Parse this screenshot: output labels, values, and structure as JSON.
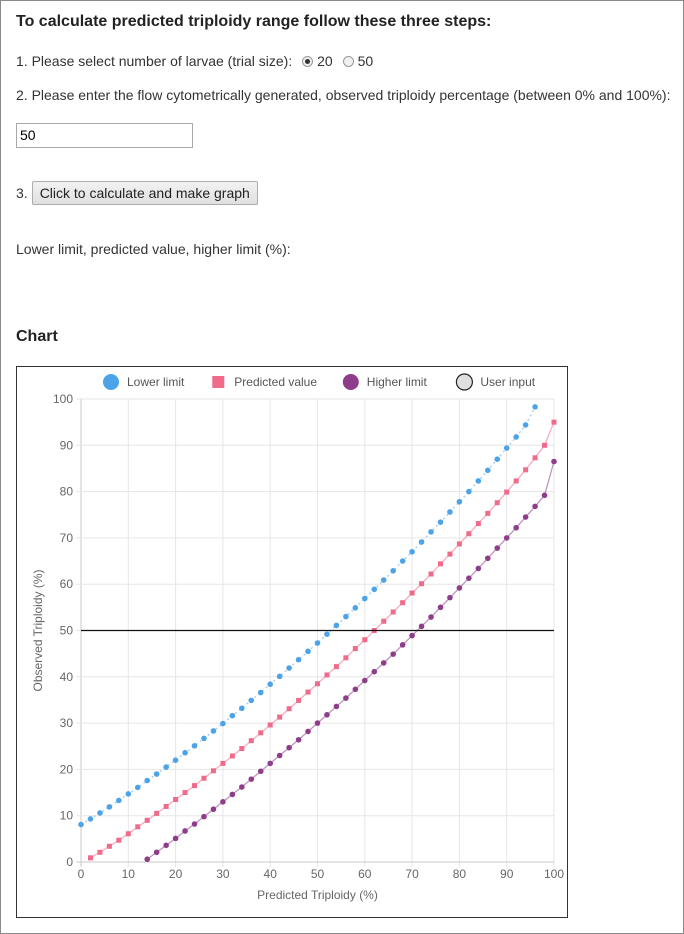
{
  "header": {
    "title": "To calculate predicted triploidy range follow these three steps:"
  },
  "step1": {
    "label": "1. Please select number of larvae (trial size):",
    "options": [
      {
        "label": "20",
        "selected": true
      },
      {
        "label": "50",
        "selected": false
      }
    ]
  },
  "step2": {
    "label": "2. Please enter the flow cytometrically generated, observed triploidy percentage (between 0% and 100%):",
    "value": "50"
  },
  "step3": {
    "prefix": "3.",
    "button_label": "Click to calculate and make graph"
  },
  "result": {
    "label": "Lower limit, predicted value, higher limit (%):"
  },
  "chart_section": {
    "title": "Chart"
  },
  "chart_data": {
    "type": "scatter",
    "xlabel": "Predicted Triploidy (%)",
    "ylabel": "Observed Triploidy (%)",
    "xlim": [
      0,
      100
    ],
    "ylim": [
      0,
      100
    ],
    "xticks": [
      "0",
      "10",
      "20",
      "30",
      "40",
      "50",
      "60",
      "70",
      "80",
      "90",
      "100"
    ],
    "yticks": [
      "0",
      "10",
      "20",
      "30",
      "40",
      "50",
      "60",
      "70",
      "80",
      "90",
      "100"
    ],
    "grid": true,
    "legend_position": "top",
    "series": [
      {
        "name": "Lower limit",
        "color": "#4da3e8",
        "marker": "circle",
        "line": "dotted",
        "x": [
          0,
          2,
          4,
          6,
          8,
          10,
          12,
          14,
          16,
          18,
          20,
          22,
          24,
          26,
          28,
          30,
          32,
          34,
          36,
          38,
          40,
          42,
          44,
          46,
          48,
          50,
          52,
          54,
          56,
          58,
          60,
          62,
          64,
          66,
          68,
          70,
          72,
          74,
          76,
          78,
          80,
          82,
          84,
          86,
          88,
          90,
          92,
          94,
          96
        ],
        "y": [
          8.1,
          9.3,
          10.6,
          11.9,
          13.3,
          14.7,
          16.1,
          17.6,
          19.0,
          20.5,
          22.0,
          23.6,
          25.1,
          26.7,
          28.3,
          29.9,
          31.6,
          33.2,
          34.9,
          36.6,
          38.4,
          40.1,
          41.9,
          43.7,
          45.5,
          47.3,
          49.2,
          51.1,
          53.0,
          54.9,
          56.9,
          58.9,
          60.9,
          62.9,
          65.0,
          67.0,
          69.1,
          71.3,
          73.4,
          75.6,
          77.8,
          80.0,
          82.3,
          84.6,
          87.0,
          89.4,
          91.8,
          94.4,
          98.3
        ]
      },
      {
        "name": "Predicted value",
        "color": "#f06a8a",
        "marker": "square",
        "line": "solid",
        "x": [
          2,
          4,
          6,
          8,
          10,
          12,
          14,
          16,
          18,
          20,
          22,
          24,
          26,
          28,
          30,
          32,
          34,
          36,
          38,
          40,
          42,
          44,
          46,
          48,
          50,
          52,
          54,
          56,
          58,
          60,
          62,
          64,
          66,
          68,
          70,
          72,
          74,
          76,
          78,
          80,
          82,
          84,
          86,
          88,
          90,
          92,
          94,
          96,
          98,
          100
        ],
        "y": [
          0.9,
          2.1,
          3.4,
          4.7,
          6.1,
          7.6,
          9.0,
          10.5,
          12.0,
          13.5,
          15.0,
          16.5,
          18.1,
          19.7,
          21.3,
          22.9,
          24.5,
          26.2,
          27.9,
          29.6,
          31.3,
          33.1,
          34.9,
          36.7,
          38.5,
          40.4,
          42.2,
          44.1,
          46.1,
          48.0,
          50.0,
          52.0,
          54.0,
          56.0,
          58.1,
          60.1,
          62.2,
          64.4,
          66.5,
          68.7,
          70.9,
          73.1,
          75.3,
          77.6,
          79.9,
          82.3,
          84.7,
          87.3,
          90.0,
          95.0
        ]
      },
      {
        "name": "Higher limit",
        "color": "#8e3d8b",
        "marker": "circle",
        "line": "solid",
        "x": [
          14,
          16,
          18,
          20,
          22,
          24,
          26,
          28,
          30,
          32,
          34,
          36,
          38,
          40,
          42,
          44,
          46,
          48,
          50,
          52,
          54,
          56,
          58,
          60,
          62,
          64,
          66,
          68,
          70,
          72,
          74,
          76,
          78,
          80,
          82,
          84,
          86,
          88,
          90,
          92,
          94,
          96,
          98,
          100
        ],
        "y": [
          0.6,
          2.1,
          3.6,
          5.1,
          6.7,
          8.2,
          9.8,
          11.4,
          13.0,
          14.6,
          16.2,
          17.9,
          19.6,
          21.3,
          23.0,
          24.7,
          26.4,
          28.2,
          30.0,
          31.8,
          33.6,
          35.4,
          37.3,
          39.2,
          41.1,
          43.0,
          44.9,
          46.9,
          48.9,
          50.9,
          52.9,
          55.0,
          57.1,
          59.2,
          61.3,
          63.4,
          65.6,
          67.8,
          70.0,
          72.2,
          74.5,
          76.8,
          79.2,
          86.5
        ]
      },
      {
        "name": "User input",
        "color": "#e0e0e0",
        "marker": "circle",
        "line": "solid",
        "type": "horizontal-line",
        "y_value": 50
      }
    ]
  }
}
